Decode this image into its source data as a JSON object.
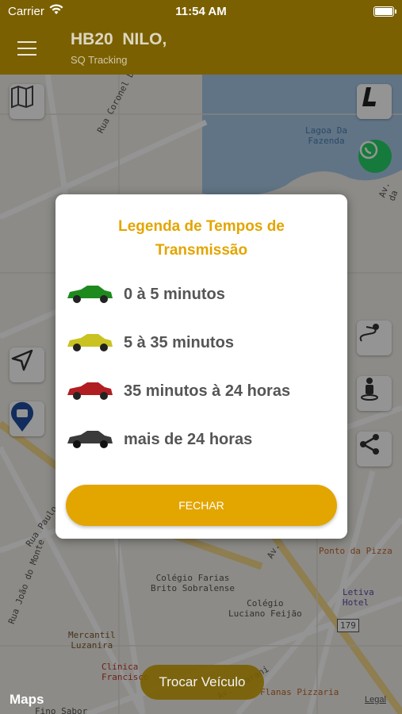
{
  "status_bar": {
    "carrier": "Carrier",
    "time": "11:54 AM"
  },
  "header": {
    "title": "HB20  NILO,",
    "subtitle": "SQ Tracking"
  },
  "map": {
    "labels": {
      "street_coronel": "Rua Coronel Diogo Gomes",
      "lagoa": "Lagoa Da\nFazenda",
      "av_top": "Av. da",
      "rua_paulo": "Rua Paulo Aragão",
      "rua_joao": "Rua João do Monte",
      "colegio_farias": "Colégio Farias\nBrito Sobralense",
      "colegio_luciano": "Colégio\nLuciano Feijão",
      "mercantil": "Mercantil\nLuzanira",
      "clinica": "Clínica\nFrancisco",
      "ponto_pizza": "Ponto da Pizza",
      "letiva": "Letiva Hotel",
      "route_179": "179",
      "av_guarani": "Av. Guarani",
      "flanas": "Flanas Pizzaria",
      "fino_sabor": "Fino Sabor",
      "av_bottom": "Av."
    }
  },
  "dialog": {
    "title": "Legenda de Tempos de\nTransmissão",
    "legend": [
      {
        "label": "0 à 5 minutos",
        "color": "#1e8a1e"
      },
      {
        "label": "5 à 35 minutos",
        "color": "#c9c220"
      },
      {
        "label": "35 minutos à 24 horas",
        "color": "#b01e22"
      },
      {
        "label": "mais de 24 horas",
        "color": "#3a3a3a"
      }
    ],
    "close_label": "FECHAR"
  },
  "footer": {
    "change_vehicle_label": "Trocar Veículo",
    "maps_logo": "Maps",
    "legal_label": "Legal"
  },
  "colors": {
    "header": "#7a6000",
    "accent": "#e3a500"
  }
}
